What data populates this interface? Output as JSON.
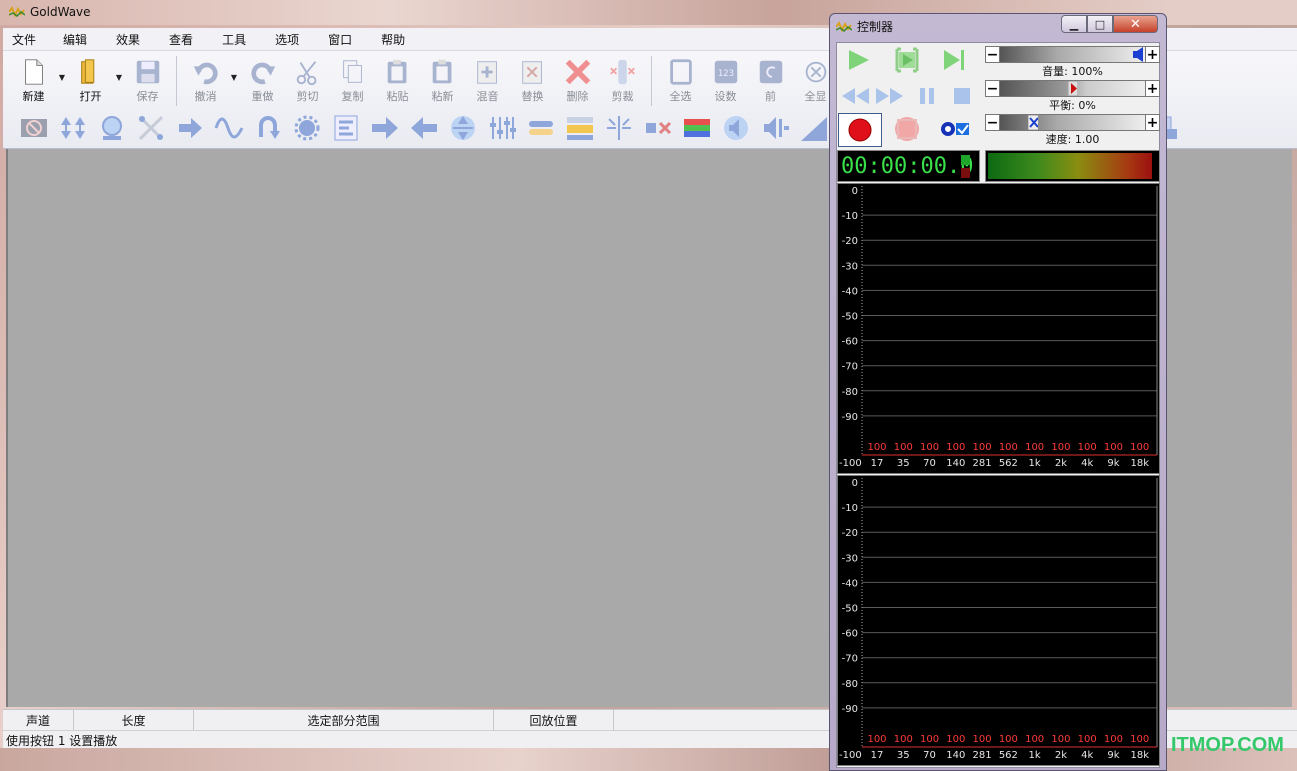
{
  "app": {
    "title": "GoldWave"
  },
  "menu": [
    "文件",
    "编辑",
    "效果",
    "查看",
    "工具",
    "选项",
    "窗口",
    "帮助"
  ],
  "toolbar": {
    "buttons": [
      {
        "label": "新建",
        "enabled": true,
        "icon": "new-file-icon",
        "dropdown": true
      },
      {
        "label": "打开",
        "enabled": true,
        "icon": "open-folder-icon",
        "dropdown": true
      },
      {
        "label": "保存",
        "enabled": false,
        "icon": "save-disk-icon"
      },
      {
        "label": "撤消",
        "enabled": false,
        "icon": "undo-icon",
        "dropdown": true
      },
      {
        "label": "重做",
        "enabled": false,
        "icon": "redo-icon"
      },
      {
        "label": "剪切",
        "enabled": false,
        "icon": "scissors-icon"
      },
      {
        "label": "复制",
        "enabled": false,
        "icon": "copy-icon"
      },
      {
        "label": "粘贴",
        "enabled": false,
        "icon": "paste-icon"
      },
      {
        "label": "粘新",
        "enabled": false,
        "icon": "paste-new-icon"
      },
      {
        "label": "混音",
        "enabled": false,
        "icon": "mix-icon"
      },
      {
        "label": "替换",
        "enabled": false,
        "icon": "replace-icon"
      },
      {
        "label": "删除",
        "enabled": false,
        "icon": "delete-icon"
      },
      {
        "label": "剪裁",
        "enabled": false,
        "icon": "trim-icon"
      },
      {
        "label": "全选",
        "enabled": false,
        "icon": "select-all-icon"
      },
      {
        "label": "设数",
        "enabled": false,
        "icon": "set-marker-icon"
      },
      {
        "label": "前",
        "enabled": false,
        "icon": "previous-icon"
      },
      {
        "label": "全显",
        "enabled": false,
        "icon": "view-all-icon"
      }
    ],
    "effects_count": 30
  },
  "status": {
    "columns": [
      "声道",
      "长度",
      "选定部分范围",
      "回放位置"
    ],
    "message": "使用按钮 1 设置播放"
  },
  "controller": {
    "title": "控制器",
    "volume": {
      "label": "音量: 100%",
      "value": 100
    },
    "balance": {
      "label": "平衡: 0%",
      "value": 0
    },
    "speed": {
      "label": "速度: 1.00",
      "value": 1.0
    },
    "time": "00:00:00.0",
    "level_fraction": 0.96,
    "spectrum": {
      "db_ticks": [
        "0",
        "-10",
        "-20",
        "-30",
        "-40",
        "-50",
        "-60",
        "-70",
        "-80",
        "-90",
        "-100"
      ],
      "freq_labels": [
        "17",
        "35",
        "70",
        "140",
        "281",
        "562",
        "1k",
        "2k",
        "4k",
        "9k",
        "18k"
      ],
      "peak_labels": [
        "100",
        "100",
        "100",
        "100",
        "100",
        "100",
        "100",
        "100",
        "100",
        "100",
        "100"
      ]
    }
  },
  "watermark": "ITMOP.COM"
}
